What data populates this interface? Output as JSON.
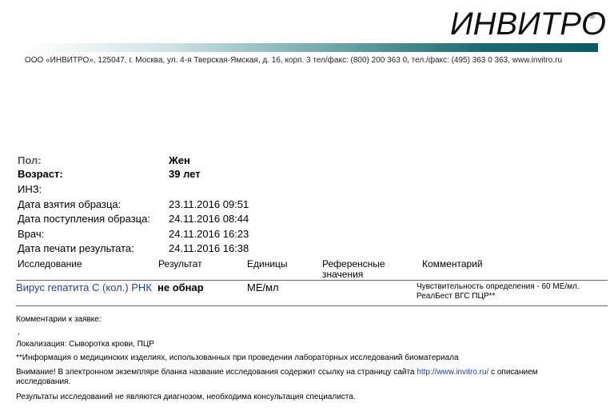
{
  "header": {
    "logo": "ИНВИТРО",
    "logo_mark": "®",
    "address": "ООО «ИНВИТРО», 125047, г. Москва, ул. 4-я Тверская-Ямская, д. 16, корп. 3  тел/факс: (800) 200 363 0, тел./факс: (495) 363 0 363, www.invitro.ru"
  },
  "patient": {
    "sex_label": "Пол:",
    "sex_value": "Жен",
    "age_label": "Возраст:",
    "age_value": "39 лет",
    "inz_label": "ИНЗ:",
    "collect_label": "Дата взятия образца:",
    "collect_value": "23.11.2016 09:51",
    "received_label": "Дата поступления образца:",
    "received_value": "24.11.2016 08:44",
    "doctor_label": "Врач:",
    "doctor_value": "24.11.2016 16:23",
    "print_label": "Дата печати результата:",
    "print_value": "24.11.2016 16:38"
  },
  "table": {
    "headers": {
      "study": "Исследование",
      "result": "Результат",
      "units": "Единицы",
      "reference_1": "Референсные",
      "reference_2": "значения",
      "comment": "Комментарий"
    },
    "row": {
      "study": "Вирус гепатита С (кол.) РНК",
      "result": "не обнар",
      "units": "МЕ/мл",
      "comment": "Чувствительность определения - 60 МЕ/мл. РеалБест ВГС ПЦР**"
    }
  },
  "footer": {
    "comments_label": "Комментарии к заявке:",
    "comma": ",",
    "localization": "Локализация: Сыворотка крови, ПЦР",
    "devices": "**Информация о медицинских изделиях, использованных при проведении лабораторных исследований биоматериала",
    "notice_before": "Внимание! В электронном экземпляре бланка название исследования содержит ссылку на страницу сайта ",
    "notice_link": "http://www.invitro.ru/",
    "notice_after": " с описанием исследования.",
    "disclaimer": "Результаты исследований не являются диагнозом, необходима консультация специалиста."
  }
}
